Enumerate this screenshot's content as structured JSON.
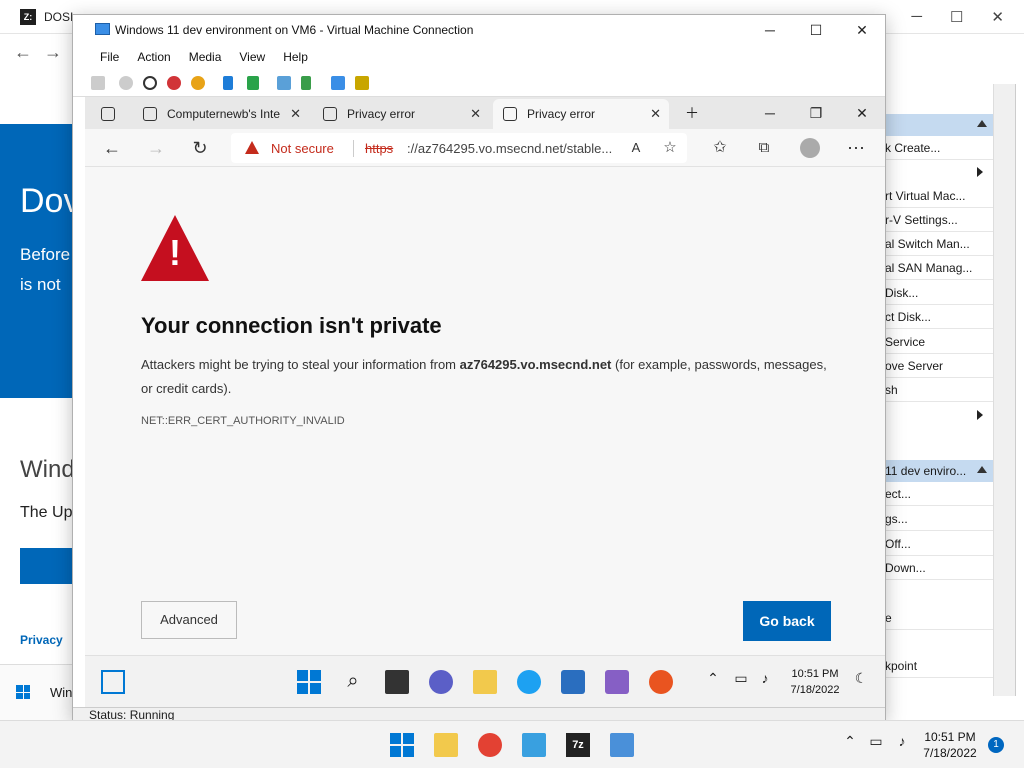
{
  "host_browser": {
    "title": "DOSI",
    "hero_heading": "Dov",
    "hero_text_1": "Before",
    "hero_text_2": "is not",
    "section_heading": "Wind",
    "section_sub": "The Up",
    "privacy_link": "Privacy",
    "bottom_tab": "Win"
  },
  "hyperv_actions": {
    "items_top": [
      "k Create...",
      "rt Virtual Mac...",
      "r-V Settings...",
      "al Switch Man...",
      "al SAN Manag...",
      "Disk...",
      "ct Disk...",
      "Service",
      "ove Server",
      "sh"
    ],
    "section_header": "11 dev enviro...",
    "items_vm": [
      "ect...",
      "gs...",
      "Off...",
      "Down...",
      "e",
      "kpoint"
    ]
  },
  "vm_window": {
    "title": "Windows 11 dev environment on VM6 - Virtual Machine Connection",
    "menu": [
      "File",
      "Action",
      "Media",
      "View",
      "Help"
    ],
    "status": "Status: Running"
  },
  "edge": {
    "tabs": [
      {
        "label": "Computernewb's Inte"
      },
      {
        "label": "Privacy error"
      },
      {
        "label": "Privacy error"
      }
    ],
    "not_secure": "Not secure",
    "url_scheme": "https",
    "url_rest": "://az764295.vo.msecnd.net/stable...",
    "page": {
      "title": "Your connection isn't private",
      "desc_pre": "Attackers might be trying to steal your information from ",
      "desc_host": "az764295.vo.msecnd.net",
      "desc_post": " (for example, passwords, messages, or credit cards).",
      "error_code": "NET::ERR_CERT_AUTHORITY_INVALID",
      "advanced_label": "Advanced",
      "go_back_label": "Go back"
    }
  },
  "guest_taskbar": {
    "time": "10:51 PM",
    "date": "7/18/2022"
  },
  "host_taskbar": {
    "time": "10:51 PM",
    "date": "7/18/2022",
    "badge": "1"
  },
  "colors": {
    "accent": "#0067b8",
    "error": "#c50f1f"
  }
}
